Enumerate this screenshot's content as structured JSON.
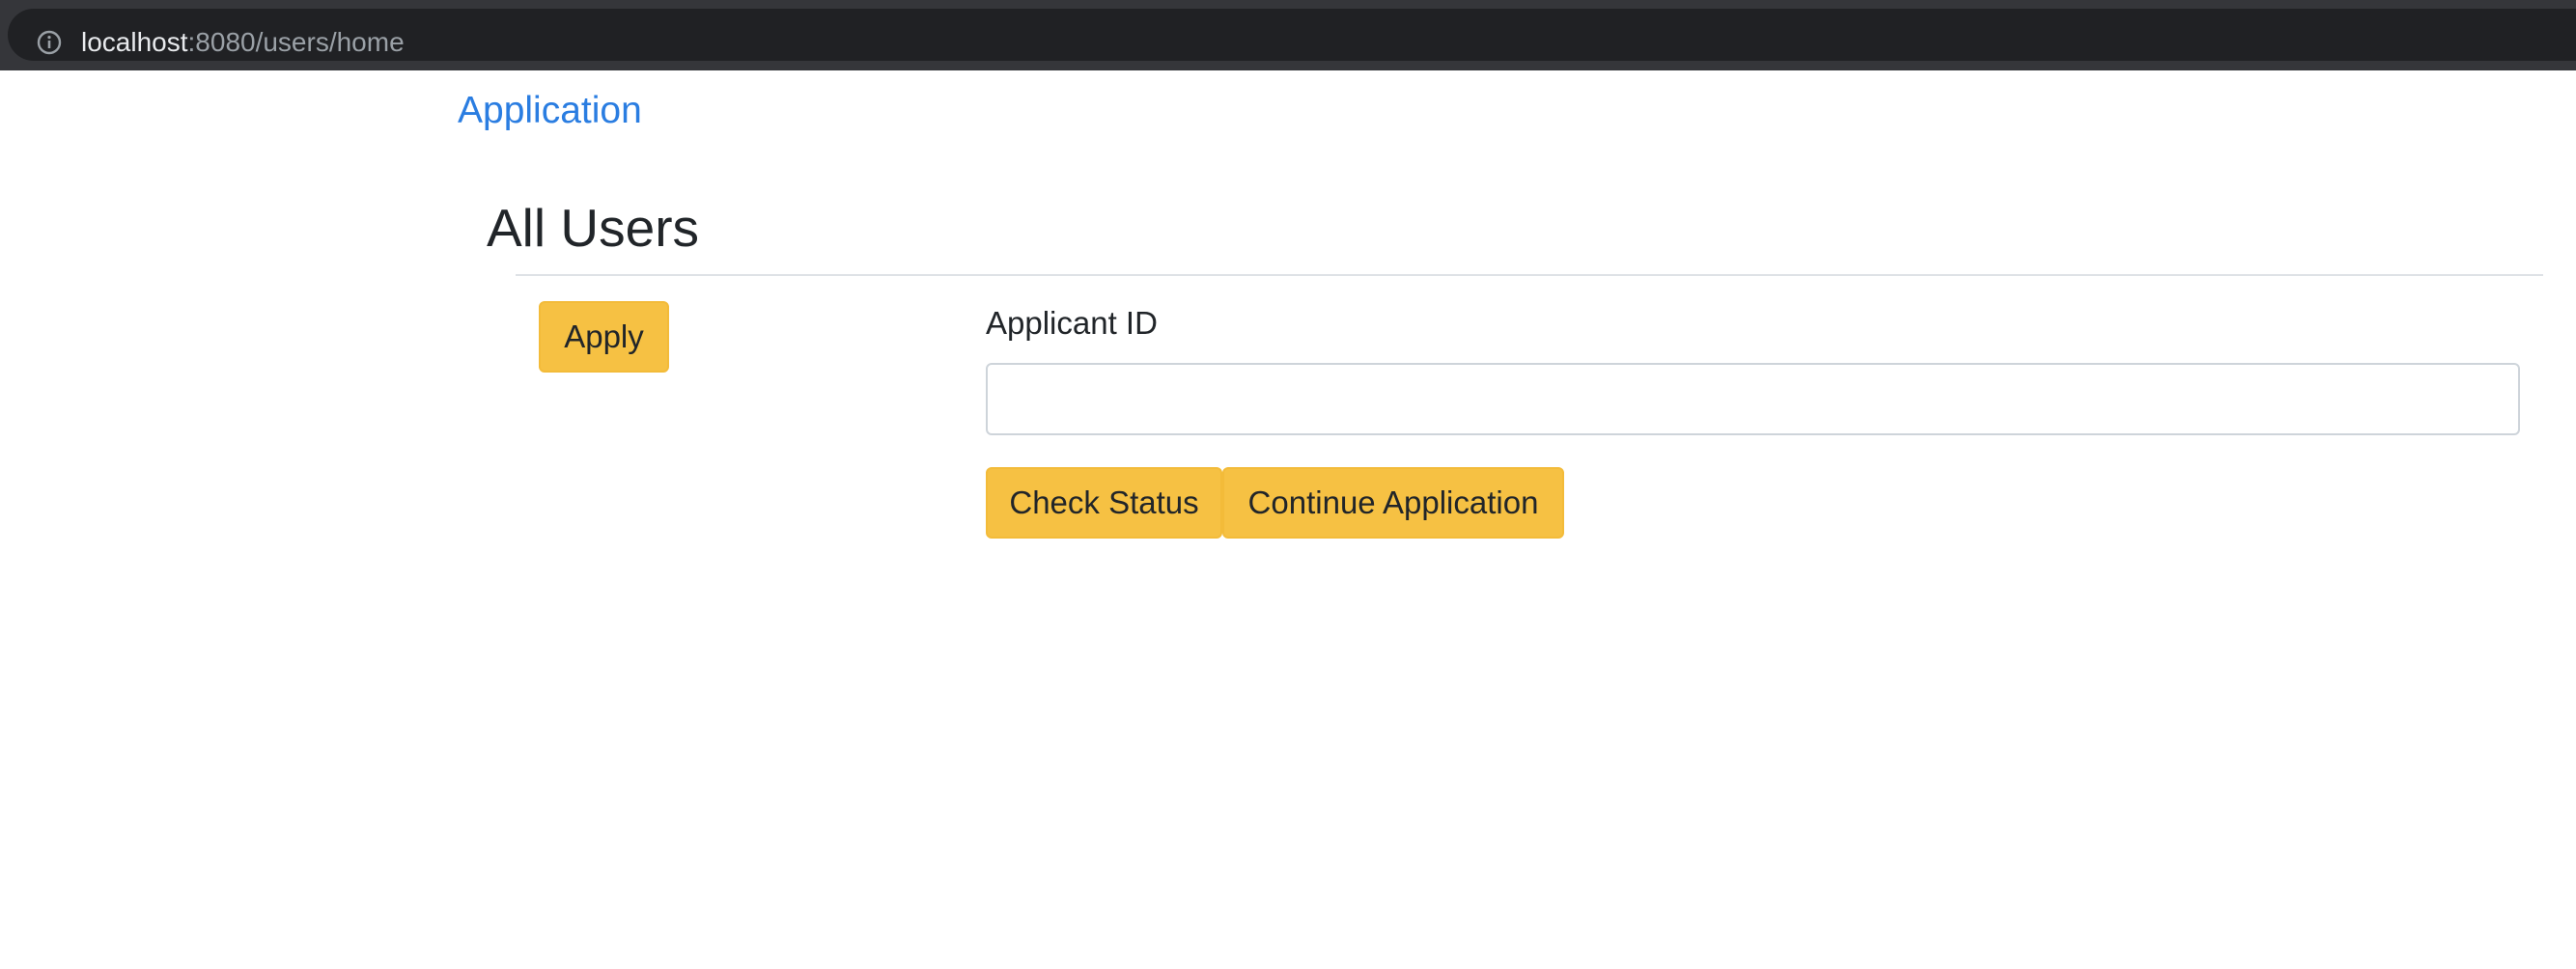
{
  "browser": {
    "url_host": "localhost",
    "url_rest": ":8080/users/home",
    "info_icon": "info-icon"
  },
  "nav": {
    "brand": "Application"
  },
  "main": {
    "title": "All Users",
    "apply_label": "Apply",
    "applicant_id_label": "Applicant ID",
    "applicant_id_value": "",
    "applicant_id_placeholder": "",
    "check_status_label": "Check Status",
    "continue_label": "Continue Application"
  },
  "colors": {
    "accent_button": "#f6c143",
    "link": "#2a7de1",
    "text": "#212529",
    "browser_bar": "#35363a"
  }
}
